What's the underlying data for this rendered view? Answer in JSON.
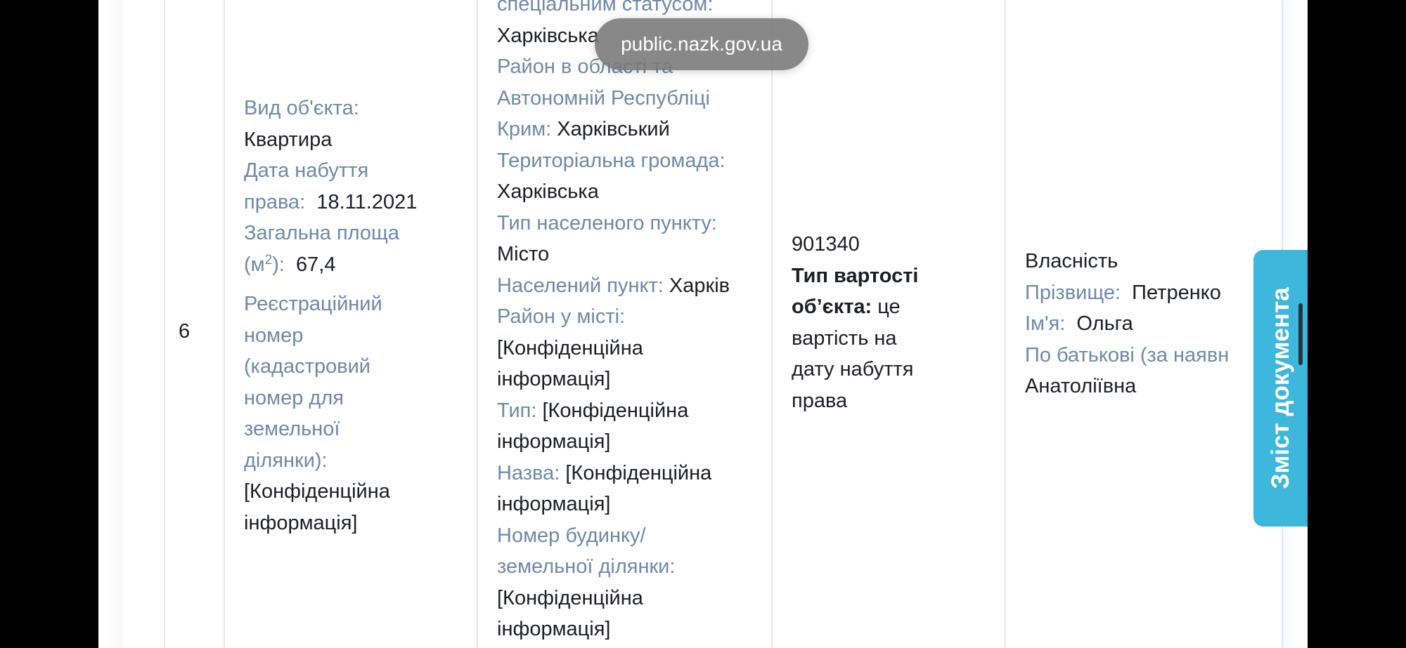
{
  "toast": {
    "url": "public.nazk.gov.ua"
  },
  "row": {
    "number": "6",
    "object": {
      "type_label": "Вид об'єкта:",
      "type_value": "Квартира",
      "acq_label_1": "Дата набуття",
      "acq_label_2": "права:",
      "acq_value": "18.11.2021",
      "area_label_1": "Загальна площа",
      "area_label_2a": "(м",
      "area_label_sup": "2",
      "area_label_2b": "):",
      "area_value": "67,4",
      "reg_label_1": "Реєстраційний",
      "reg_label_2": "номер",
      "reg_label_3": "(кадастровий",
      "reg_label_4": "номер для",
      "reg_label_5": "земельної",
      "reg_label_6": "ділянки):",
      "reg_value_1": "[Конфіденційна",
      "reg_value_2": "інформація]"
    },
    "address": {
      "status_label": "спеціальним статусом:",
      "status_value": "Харківська",
      "district_label_1": "Район в області та",
      "district_label_2": "Автономній Республіці",
      "district_label_3": "Крим:",
      "district_value": "Харківський",
      "community_label": "Територіальна громада:",
      "community_value": "Харківська",
      "settlement_type_label": "Тип населеного пункту:",
      "settlement_type_value": "Місто",
      "settlement_label": "Населений пункт:",
      "settlement_value": "Харків",
      "city_district_label": "Район у місті:",
      "conf_1": "[Конфіденційна",
      "conf_2": "інформація]",
      "type_label": "Тип:",
      "name_label": "Назва:",
      "house_label_1": "Номер будинку/",
      "house_label_2": "земельної ділянки:"
    },
    "cost": {
      "value": "901340",
      "type_label_1": "Тип вартості",
      "type_label_2": "об’єкта:",
      "type_value_1": "це",
      "type_value_2": "вартість на",
      "type_value_3": "дату набуття",
      "type_value_4": "права"
    },
    "rights": {
      "right_type": "Власність",
      "surname_label": "Прізвище:",
      "surname_value": "Петренко",
      "name_label": "Ім'я:",
      "name_value": "Ольга",
      "patronymic_label": "По батькові (за наявн",
      "patronymic_value": "Анатоліївна"
    }
  },
  "toc": {
    "label": "Зміст документа"
  },
  "colors": {
    "label": "#6e89a9",
    "text": "#1b1e24",
    "toc_bg": "#3db7db",
    "border": "#e3e7ee"
  }
}
